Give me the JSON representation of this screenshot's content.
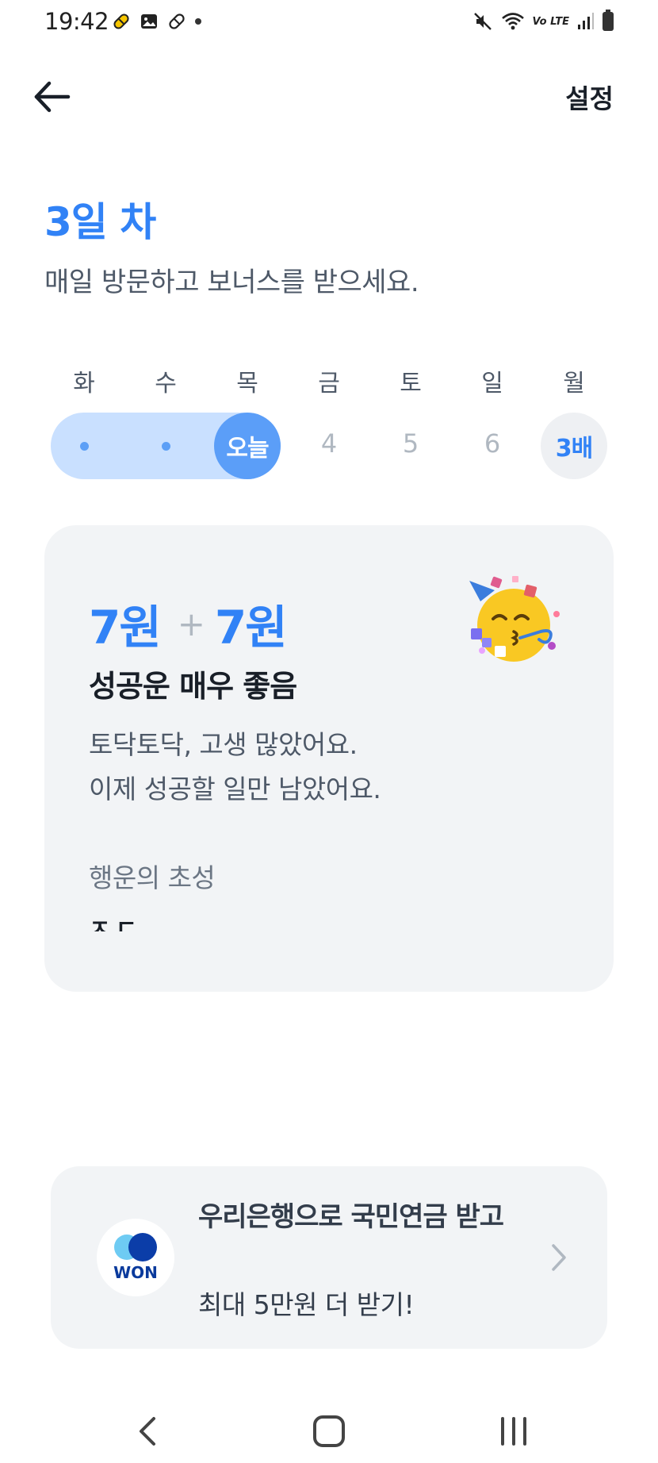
{
  "status_bar": {
    "time": "19:42",
    "left_icons": [
      "pill-icon",
      "image-icon",
      "link-icon",
      "dot-icon"
    ],
    "right_icons": [
      "mute-icon",
      "wifi-icon",
      "volte-icon",
      "signal-icon",
      "battery-icon"
    ],
    "volte_label": "Vo LTE"
  },
  "header": {
    "back_icon": "arrow-left-icon",
    "settings_label": "설정"
  },
  "attendance": {
    "day_title": "3일 차",
    "subtitle": "매일 방문하고 보너스를 받으세요.",
    "weekdays": [
      "화",
      "수",
      "목",
      "금",
      "토",
      "일",
      "월"
    ],
    "today_label": "오늘",
    "upcoming_days": [
      "4",
      "5",
      "6"
    ],
    "bonus_label": "3배",
    "completed_days": 2
  },
  "fortune": {
    "base_amount": "7원",
    "plus_sign": "+",
    "bonus_amount": "7원",
    "title": "성공운 매우 좋음",
    "lines": [
      "토닥토닥, 고생 많았어요.",
      "이제 성공할 일만 남았어요."
    ],
    "luck_label": "행운의 초성",
    "luck_value": "ㅈㄷ",
    "emoji": "party-face-icon"
  },
  "bank_banner": {
    "logo_text": "WON",
    "title": "우리은행으로 국민연금 받고",
    "subtitle": "최대 5만원 더 받기!",
    "arrow_icon": "chevron-right-icon"
  },
  "navigation": {
    "back": "nav-back-icon",
    "home": "nav-home-icon",
    "recents": "nav-recents-icon"
  },
  "colors": {
    "accent": "#3182f6",
    "track": "#c9e0ff",
    "today": "#5b9ef8",
    "card_bg": "#f2f4f6"
  }
}
